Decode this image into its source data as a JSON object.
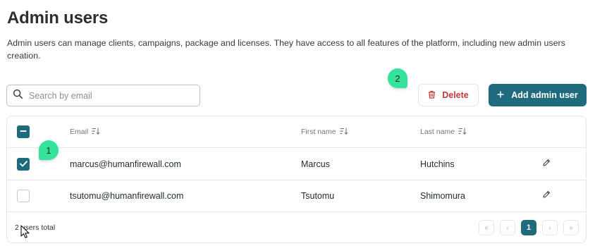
{
  "page": {
    "title": "Admin users",
    "description": "Admin users can manage clients, campaigns, package and licenses. They have access to all features of the platform, including new admin users creation."
  },
  "search": {
    "placeholder": "Search by email",
    "value": ""
  },
  "actions": {
    "delete_label": "Delete",
    "add_label": "Add admin user"
  },
  "table": {
    "columns": [
      {
        "label": "Email",
        "sortable": true
      },
      {
        "label": "First name",
        "sortable": true
      },
      {
        "label": "Last name",
        "sortable": true
      }
    ],
    "select_all_state": "indeterminate",
    "rows": [
      {
        "selected": true,
        "email": "marcus@humanfirewall.com",
        "first_name": "Marcus",
        "last_name": "Hutchins"
      },
      {
        "selected": false,
        "email": "tsutomu@humanfirewall.com",
        "first_name": "Tsutomu",
        "last_name": "Shimomura"
      }
    ]
  },
  "footer": {
    "total_text": "2 users total",
    "pagination": {
      "first": "«",
      "prev": "‹",
      "current_page": "1",
      "next": "›",
      "last": "»"
    }
  },
  "annotations": {
    "marker_1": "1",
    "marker_2": "2"
  },
  "colors": {
    "primary": "#1e6b7d",
    "danger": "#c43a3a",
    "marker": "#35e39a",
    "border": "#e4e7ea"
  },
  "icons": {
    "search": "search-icon",
    "delete": "trash-icon",
    "add": "plus-icon",
    "sort": "sort-icon",
    "edit": "pencil-icon",
    "checkbox_checked": "check-icon",
    "checkbox_indeterminate": "minus-icon"
  }
}
